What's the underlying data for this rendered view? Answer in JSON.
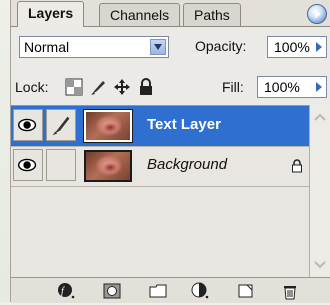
{
  "tabs": [
    {
      "label": "Layers",
      "active": true
    },
    {
      "label": "Channels",
      "active": false
    },
    {
      "label": "Paths",
      "active": false
    }
  ],
  "blend_mode": "Normal",
  "opacity": {
    "label": "Opacity:",
    "value": "100%"
  },
  "lock": {
    "label": "Lock:",
    "icons": [
      "lock-transparent-icon",
      "lock-paint-icon",
      "lock-move-icon",
      "lock-all-icon"
    ]
  },
  "fill": {
    "label": "Fill:",
    "value": "100%"
  },
  "layers": [
    {
      "name": "Text Layer",
      "selected": true,
      "visible": true,
      "locked": false
    },
    {
      "name": "Background",
      "selected": false,
      "visible": true,
      "locked": true
    }
  ],
  "bottom_tools": [
    "layer-style-icon",
    "layer-mask-icon",
    "new-group-icon",
    "adjustment-layer-icon",
    "new-layer-icon",
    "trash-icon"
  ],
  "colors": {
    "selection": "#2f6fcf",
    "panel": "#eceae6",
    "accent": "#3a68b7"
  }
}
